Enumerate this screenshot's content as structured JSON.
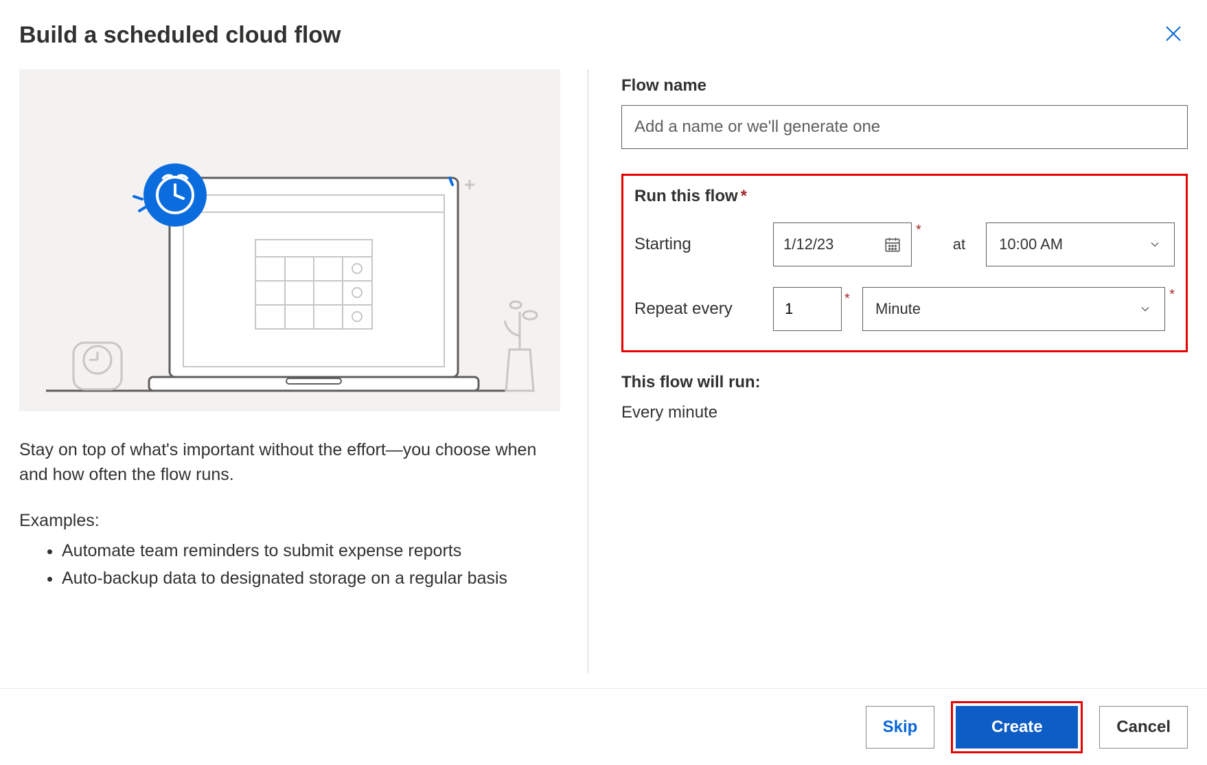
{
  "title": "Build a scheduled cloud flow",
  "left": {
    "description": "Stay on top of what's important without the effort—you choose when and how often the flow runs.",
    "examples_label": "Examples:",
    "examples": [
      "Automate team reminders to submit expense reports",
      "Auto-backup data to designated storage on a regular basis"
    ]
  },
  "right": {
    "flow_name_label": "Flow name",
    "flow_name_placeholder": "Add a name or we'll generate one",
    "flow_name_value": "",
    "run_section_label": "Run this flow",
    "starting_label": "Starting",
    "starting_date": "1/12/23",
    "at_label": "at",
    "starting_time": "10:00 AM",
    "repeat_label": "Repeat every",
    "repeat_value": "1",
    "repeat_unit": "Minute",
    "summary_label": "This flow will run:",
    "summary_text": "Every minute"
  },
  "footer": {
    "skip": "Skip",
    "create": "Create",
    "cancel": "Cancel"
  },
  "colors": {
    "primary": "#0e5cc5",
    "highlight_border": "#e60000"
  }
}
